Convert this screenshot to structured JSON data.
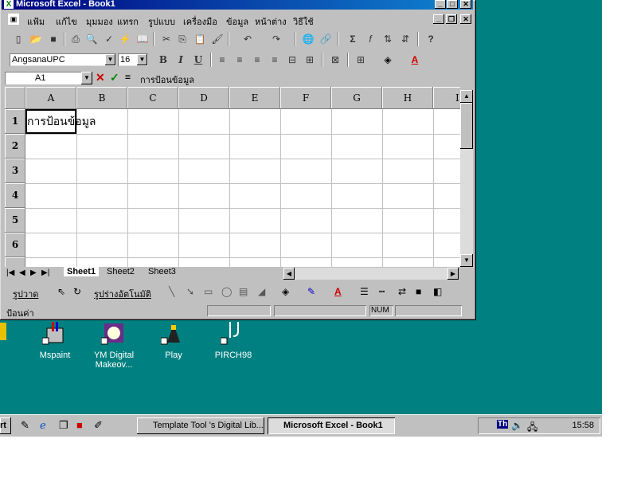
{
  "window": {
    "title": "Microsoft Excel - Book1"
  },
  "menu": [
    "แฟ้ม",
    "แก้ไข",
    "มุมมอง",
    "แทรก",
    "รูปแบบ",
    "เครื่องมือ",
    "ข้อมูล",
    "หน้าต่าง",
    "วิธีใช้"
  ],
  "formatting": {
    "font": "AngsanaUPC",
    "size": "16",
    "bold": "B",
    "italic": "I",
    "underline": "U"
  },
  "formula_bar": {
    "cell_ref": "A1",
    "equals": "=",
    "value": "การป้อนข้อมูล"
  },
  "columns": [
    "A",
    "B",
    "C",
    "D",
    "E",
    "F",
    "G",
    "H",
    "I"
  ],
  "rows": [
    "1",
    "2",
    "3",
    "4",
    "5",
    "6"
  ],
  "cells": {
    "A1": "การป้อนข้อมูล"
  },
  "sheet_tabs": [
    "Sheet1",
    "Sheet2",
    "Sheet3"
  ],
  "drawing_toolbar": {
    "draw": "รูปวาด",
    "autoshapes": "รูปร่างอัตโนมัติ"
  },
  "status": {
    "mode": "ป้อนค่า",
    "num": "NUM"
  },
  "desktop_icons": [
    {
      "label": "Mspaint"
    },
    {
      "label": "YM Digital Makeov..."
    },
    {
      "label": "Play"
    },
    {
      "label": "PIRCH98"
    }
  ],
  "taskbar": {
    "start": "rt",
    "tasks": [
      "Template Tool 's Digital Lib...",
      "Microsoft Excel - Book1"
    ],
    "clock": "15:58",
    "lang": "Th"
  },
  "colors": {
    "title": "#000080",
    "desktop": "#008080",
    "face": "#c0c0c0"
  }
}
